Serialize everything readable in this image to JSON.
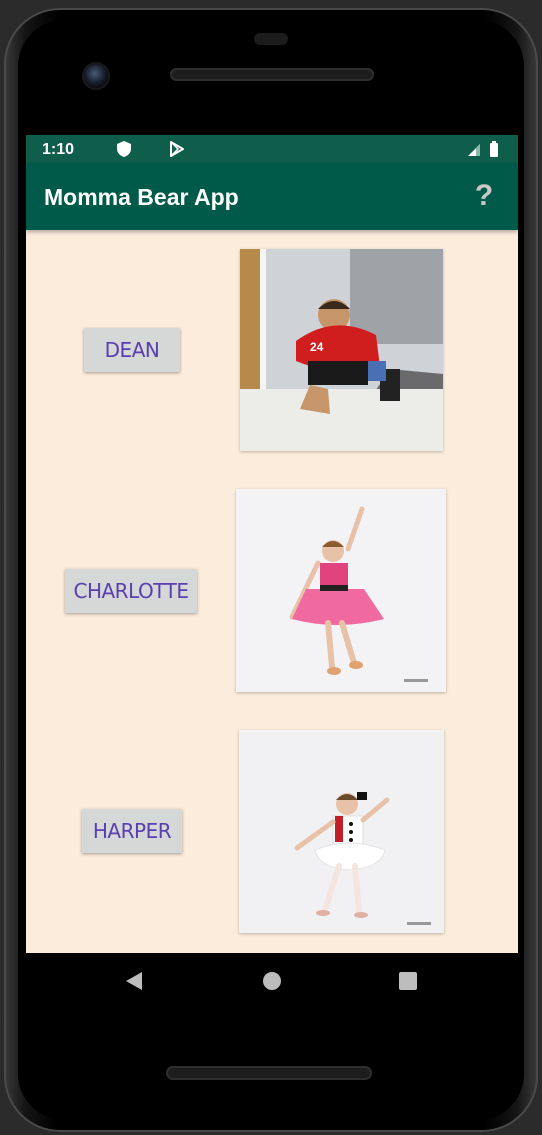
{
  "status_bar": {
    "time": "1:10",
    "icons": [
      "shield-icon",
      "play-store-icon",
      "signal-icon",
      "battery-icon"
    ]
  },
  "app_bar": {
    "title": "Momma Bear App",
    "help_label": "?"
  },
  "kids": [
    {
      "name": "DEAN",
      "photo": "boy-football-photo"
    },
    {
      "name": "CHARLOTTE",
      "photo": "girl-pink-dance-photo"
    },
    {
      "name": "HARPER",
      "photo": "girl-white-tutu-photo"
    }
  ],
  "nav_bar": {
    "icons": [
      "back-icon",
      "home-icon",
      "recents-icon"
    ]
  },
  "colors": {
    "status_bar": "#0f5e4c",
    "app_bar": "#005a4a",
    "background": "#fcecdc",
    "button_bg": "#d6d7d7",
    "button_text": "#5a3fb0"
  }
}
